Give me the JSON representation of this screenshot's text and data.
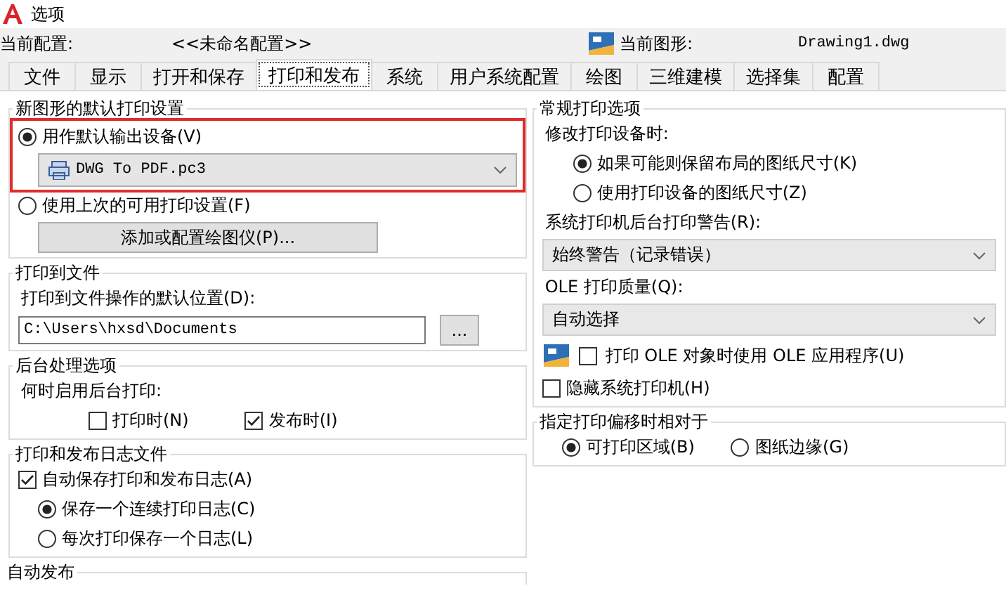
{
  "window": {
    "title": "选项"
  },
  "profile": {
    "label": "当前配置:",
    "value": "<<未命名配置>>"
  },
  "drawing": {
    "label": "当前图形:",
    "value": "Drawing1.dwg"
  },
  "tabs": [
    {
      "label": "文件",
      "selected": false
    },
    {
      "label": "显示",
      "selected": false
    },
    {
      "label": "打开和保存",
      "selected": false
    },
    {
      "label": "打印和发布",
      "selected": true
    },
    {
      "label": "系统",
      "selected": false
    },
    {
      "label": "用户系统配置",
      "selected": false
    },
    {
      "label": "绘图",
      "selected": false
    },
    {
      "label": "三维建模",
      "selected": false
    },
    {
      "label": "选择集",
      "selected": false
    },
    {
      "label": "配置",
      "selected": false
    }
  ],
  "left_groups": [
    {
      "title": "新图形的默认打印设置",
      "items": [
        {
          "kind": "highlight",
          "children": [
            {
              "kind": "radio",
              "label": "用作默认输出设备(V)",
              "selected": true
            },
            {
              "kind": "combo",
              "value": "DWG To PDF.pc3"
            }
          ]
        },
        {
          "kind": "radio",
          "label": "使用上次的可用打印设置(F)",
          "selected": false
        },
        {
          "kind": "button",
          "label": "添加或配置绘图仪(P)..."
        }
      ]
    },
    {
      "title": "打印到文件",
      "items": [
        {
          "kind": "label",
          "label": "打印到文件操作的默认位置(D):"
        },
        {
          "kind": "path",
          "value": "C:\\Users\\hxsd\\Documents",
          "button": "..."
        }
      ]
    },
    {
      "title": "后台处理选项",
      "items": [
        {
          "kind": "label",
          "label": "何时启用后台打印:"
        },
        {
          "kind": "checkrow",
          "children": [
            {
              "kind": "checkbox",
              "label": "打印时(N)",
              "checked": false
            },
            {
              "kind": "checkbox",
              "label": "发布时(I)",
              "checked": true
            }
          ]
        }
      ]
    },
    {
      "title": "打印和发布日志文件",
      "items": [
        {
          "kind": "checkbox",
          "label": "自动保存打印和发布日志(A)",
          "checked": true
        },
        {
          "kind": "options",
          "children": [
            {
              "kind": "radio",
              "label": "保存一个连续打印日志(C)",
              "selected": true
            },
            {
              "kind": "radio",
              "label": "每次打印保存一个日志(L)",
              "selected": false
            }
          ]
        }
      ]
    },
    {
      "title": "自动发布"
    }
  ],
  "right_groups": [
    {
      "title": "常规打印选项",
      "items": [
        {
          "kind": "label",
          "label": "修改打印设备时:"
        },
        {
          "kind": "options",
          "children": [
            {
              "kind": "radio",
              "label": "如果可能则保留布局的图纸尺寸(K)",
              "selected": true
            },
            {
              "kind": "radio",
              "label": "使用打印设备的图纸尺寸(Z)",
              "selected": false
            }
          ]
        },
        {
          "kind": "label",
          "label": "系统打印机后台打印警告(R):"
        },
        {
          "kind": "select",
          "value": "始终警告（记录错误）"
        },
        {
          "kind": "label",
          "label": "OLE 打印质量(Q):"
        },
        {
          "kind": "select",
          "value": "自动选择"
        },
        {
          "kind": "iconcheck",
          "label": "打印 OLE 对象时使用 OLE 应用程序(U)",
          "checked": false
        },
        {
          "kind": "checkbox",
          "label": "隐藏系统打印机(H)",
          "checked": false
        }
      ]
    },
    {
      "title": "指定打印偏移时相对于",
      "items": [
        {
          "kind": "radiorow",
          "children": [
            {
              "kind": "radio",
              "label": "可打印区域(B)",
              "selected": true
            },
            {
              "kind": "radio",
              "label": "图纸边缘(G)",
              "selected": false
            }
          ]
        }
      ]
    }
  ]
}
